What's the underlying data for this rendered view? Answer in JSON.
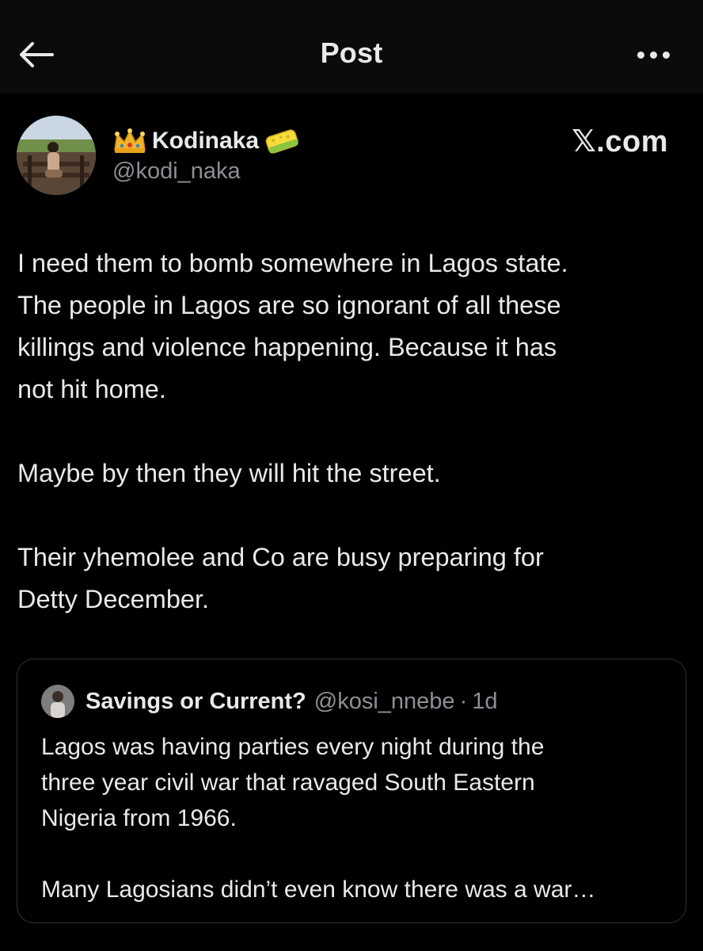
{
  "header": {
    "title": "Post",
    "back_icon": "arrow-left-icon",
    "more_icon": "more-horizontal-icon"
  },
  "author": {
    "name": "Kodinaka",
    "handle": "@kodi_naka",
    "name_prefix_emoji": "crown-icon",
    "name_suffix_emoji": "sponge-icon"
  },
  "brand": "𝕏.com",
  "post": {
    "lines": [
      "I need them to bomb somewhere in Lagos state.",
      "The people in Lagos are so ignorant of all these",
      "killings and violence happening. Because it has",
      "not hit home.",
      "",
      "Maybe by then they will hit the street.",
      "",
      "Their yhemolee and Co are busy preparing for",
      "Detty December."
    ]
  },
  "quote": {
    "name": "Savings or Current?",
    "handle": "@kosi_nnebe",
    "separator": "·",
    "time": "1d",
    "lines": [
      "Lagos was having parties every night during the",
      "three year civil war that ravaged South Eastern",
      "Nigeria from 1966.",
      "",
      "Many Lagosians didn’t even know there was a war…"
    ]
  },
  "colors": {
    "background": "#000000",
    "header_bg": "#0b0b0b",
    "text_primary": "#e7e9ea",
    "text_secondary": "#8b9096",
    "border": "#2f3336"
  }
}
